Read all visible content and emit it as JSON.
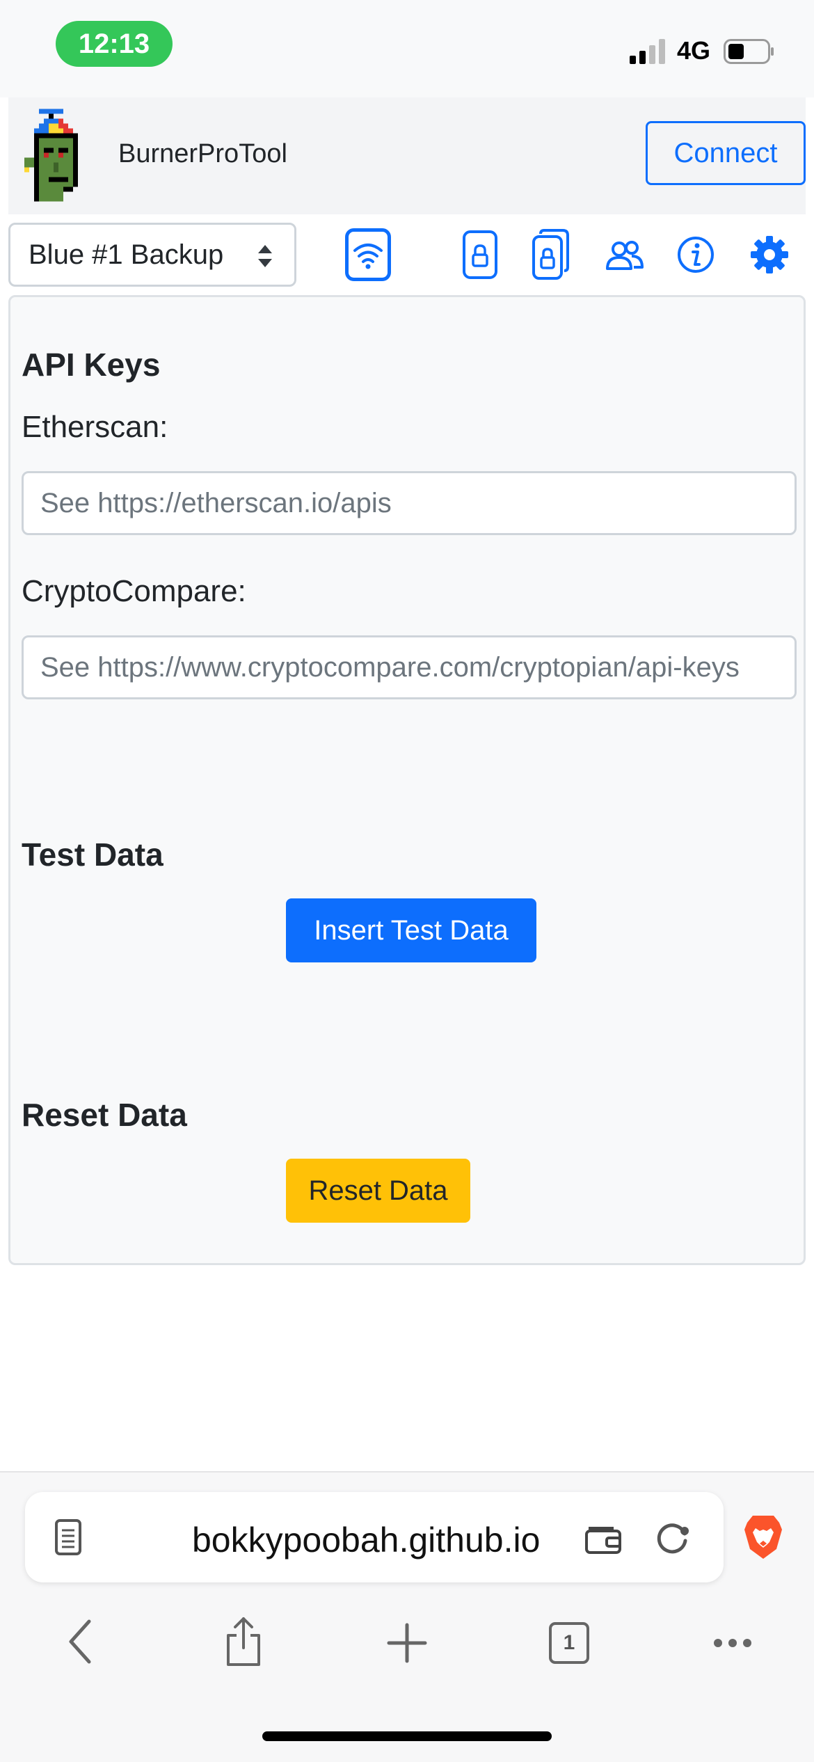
{
  "status_bar": {
    "time": "12:13",
    "network": "4G",
    "icons": [
      "signal-icon",
      "battery-icon"
    ]
  },
  "header": {
    "app_name": "BurnerProTool",
    "connect_label": "Connect",
    "logo_icon": "pixel-avatar-logo"
  },
  "toolbar": {
    "account_selected": "Blue #1 Backup",
    "icons": [
      "wifi-icon",
      "lock-icon",
      "multi-lock-icon",
      "people-icon",
      "info-icon",
      "gear-icon"
    ],
    "accent_color": "#0d6efd"
  },
  "card": {
    "api_keys_title": "API Keys",
    "etherscan_label": "Etherscan:",
    "etherscan_placeholder": "See https://etherscan.io/apis",
    "etherscan_value": "",
    "cryptocompare_label": "CryptoCompare:",
    "cryptocompare_placeholder": "See https://www.cryptocompare.com/cryptopian/api-keys",
    "cryptocompare_value": "",
    "test_data_title": "Test Data",
    "insert_test_data_label": "Insert Test Data",
    "reset_data_title": "Reset Data",
    "reset_data_label": "Reset Data",
    "warning_color": "#ffc107"
  },
  "browser": {
    "url": "bokkypoobah.github.io",
    "tab_count": "1",
    "icons": [
      "reader-icon",
      "wallet-icon",
      "reload-icon",
      "brave-lion-icon",
      "back-icon",
      "share-icon",
      "new-tab-icon",
      "tabs-icon",
      "more-icon"
    ]
  }
}
